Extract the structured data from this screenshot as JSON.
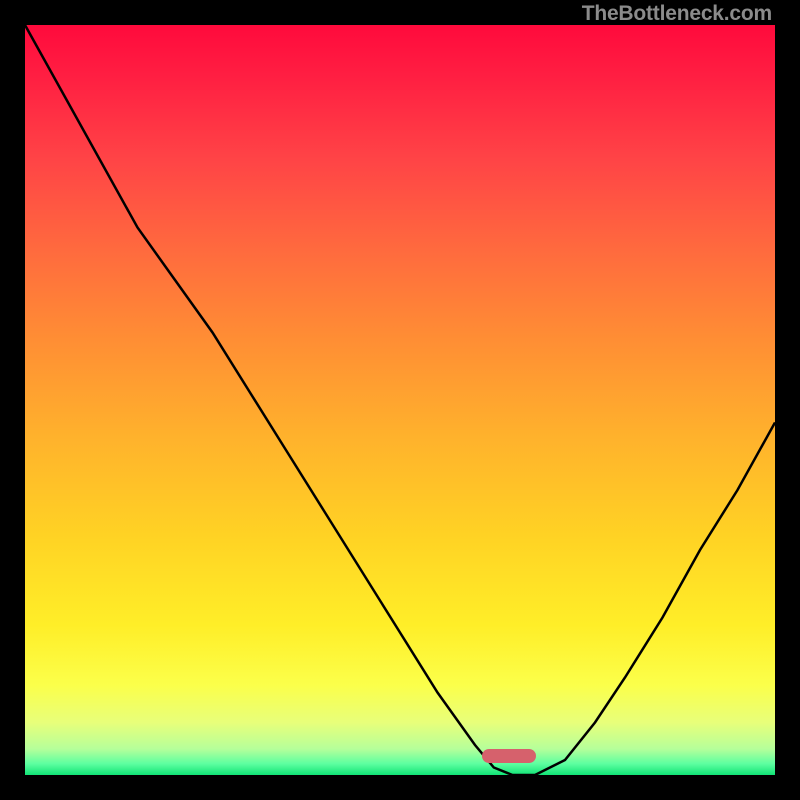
{
  "watermark": "TheBottleneck.com",
  "marker": {
    "color": "#d6616c",
    "x_frac": 0.645,
    "y_frac": 0.975
  },
  "chart_data": {
    "type": "line",
    "title": "",
    "xlabel": "",
    "ylabel": "",
    "xlim": [
      0,
      1
    ],
    "ylim": [
      0,
      1
    ],
    "x": [
      0.0,
      0.05,
      0.1,
      0.15,
      0.2,
      0.25,
      0.3,
      0.35,
      0.4,
      0.45,
      0.5,
      0.55,
      0.6,
      0.625,
      0.65,
      0.68,
      0.72,
      0.76,
      0.8,
      0.85,
      0.9,
      0.95,
      1.0
    ],
    "values": [
      1.0,
      0.91,
      0.82,
      0.73,
      0.66,
      0.59,
      0.51,
      0.43,
      0.35,
      0.27,
      0.19,
      0.11,
      0.04,
      0.01,
      0.0,
      0.0,
      0.02,
      0.07,
      0.13,
      0.21,
      0.3,
      0.38,
      0.47
    ],
    "gradient_stops": [
      {
        "pos": 0.0,
        "color": "#ff0a3c"
      },
      {
        "pos": 0.07,
        "color": "#ff1f42"
      },
      {
        "pos": 0.18,
        "color": "#ff4446"
      },
      {
        "pos": 0.3,
        "color": "#ff6a3e"
      },
      {
        "pos": 0.42,
        "color": "#ff8e34"
      },
      {
        "pos": 0.55,
        "color": "#ffb22c"
      },
      {
        "pos": 0.68,
        "color": "#ffd224"
      },
      {
        "pos": 0.8,
        "color": "#ffee28"
      },
      {
        "pos": 0.88,
        "color": "#fbff4a"
      },
      {
        "pos": 0.93,
        "color": "#e8ff7a"
      },
      {
        "pos": 0.965,
        "color": "#b6ff9a"
      },
      {
        "pos": 0.985,
        "color": "#5dffa0"
      },
      {
        "pos": 1.0,
        "color": "#11e376"
      }
    ],
    "marker_range_x": [
      0.61,
      0.69
    ]
  }
}
